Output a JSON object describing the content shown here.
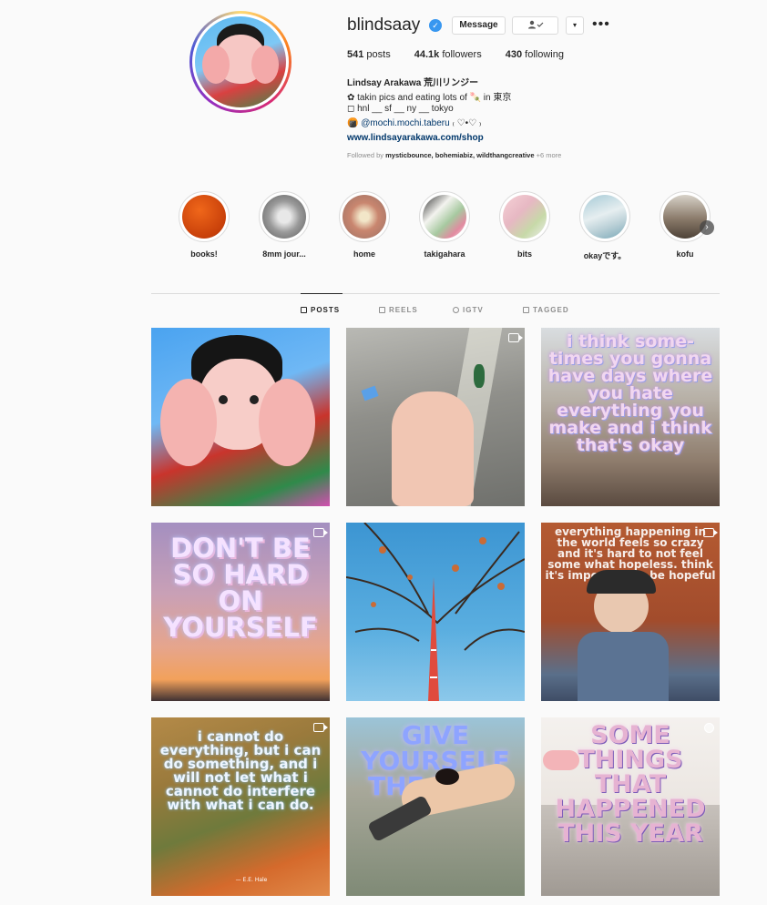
{
  "profile": {
    "username": "blindsaay",
    "verified": true,
    "buttons": {
      "message": "Message",
      "follow_icon": "person-check-icon",
      "dropdown": "▾"
    },
    "more": "•••",
    "stats": [
      {
        "count": "541",
        "label": "posts"
      },
      {
        "count": "44.1k",
        "label": "followers"
      },
      {
        "count": "430",
        "label": "following"
      }
    ],
    "full_name": "Lindsay Arakawa 荒川リンジー",
    "bio": [
      "✿ takin pics and eating lots of 🍡 in 東京",
      "◻ hnl __ sf __ ny __ tokyo"
    ],
    "bio_mention_prefix": "🍘",
    "bio_mention": "@mochi.mochi.taberu",
    "bio_mention_suffix": "₍ ♡•♡ ₎",
    "website": "www.lindsayarakawa.com/shop",
    "followed_by_prefix": "Followed by",
    "followed_by_names": "mysticbounce, bohemiabiz, wildthangcreative",
    "followed_by_more": "+6 more"
  },
  "highlights": [
    {
      "label": "books!",
      "color": "#d8470a"
    },
    {
      "label": "8mm jour...",
      "color": "#9a9a9a"
    },
    {
      "label": "home",
      "color": "#c9866f"
    },
    {
      "label": "takigahara",
      "color": "#a7c9a0"
    },
    {
      "label": "bits",
      "color": "#e7b8c3"
    },
    {
      "label": "okayです。",
      "color": "#b9cfd6"
    },
    {
      "label": "kofu",
      "color": "#8a7a6a"
    }
  ],
  "tabs": [
    {
      "label": "POSTS",
      "icon": "grid-icon",
      "active": true
    },
    {
      "label": "REELS",
      "icon": "reels-icon",
      "active": false
    },
    {
      "label": "IGTV",
      "icon": "igtv-icon",
      "active": false
    },
    {
      "label": "TAGGED",
      "icon": "tagged-icon",
      "active": false
    }
  ],
  "posts": [
    {
      "type": "image"
    },
    {
      "type": "video"
    },
    {
      "type": "image",
      "text": "i think some- times you gonna have days where you hate everything you make and i think that's okay"
    },
    {
      "type": "video",
      "text": "DON'T BE SO HARD ON YOURSELF"
    },
    {
      "type": "image"
    },
    {
      "type": "video",
      "text": "everything happening in the world feels so crazy and it's hard to not feel some what hopeless. think it's important to be hopeful too"
    },
    {
      "type": "video",
      "text": "i cannot do everything, but i can do something, and i will not let what i cannot do interfere with what i can do.",
      "credit": "— E.E. Hale"
    },
    {
      "type": "image",
      "text": "GIVE YOURSELF THE TIME"
    },
    {
      "type": "carousel",
      "text": "SOME THINGS THAT HAPPENED THIS YEAR"
    }
  ],
  "colors": {
    "link": "#00376b",
    "muted": "#8e8e8e",
    "border": "#dbdbdb",
    "verified": "#3897f0"
  }
}
